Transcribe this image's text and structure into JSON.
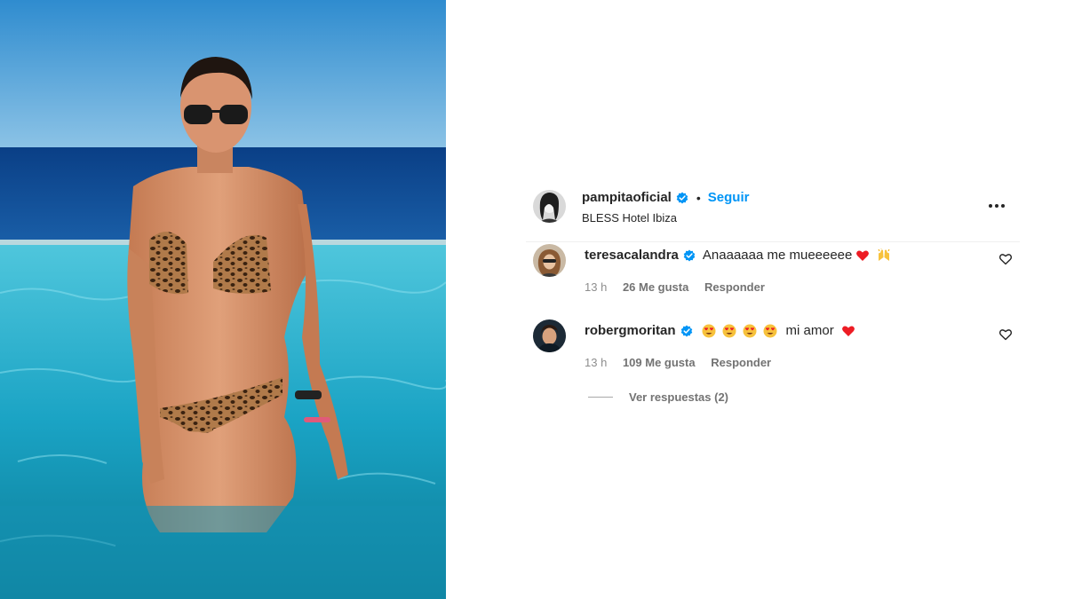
{
  "post": {
    "author": "pampitaoficial",
    "verified": true,
    "separator": "•",
    "follow_label": "Seguir",
    "location": "BLESS Hotel Ibiza",
    "more_icon": "more-horizontal-icon"
  },
  "comments": [
    {
      "username": "teresacalandra",
      "verified": true,
      "text": "Anaaaaaa me mueeeeee",
      "emojis": [
        "red-heart-emoji",
        "raising-hands-emoji"
      ],
      "time": "13 h",
      "likes": "26 Me gusta",
      "reply": "Responder"
    },
    {
      "username": "robergmoritan",
      "verified": true,
      "emojis_before": [
        "heart-eyes-emoji",
        "heart-eyes-emoji",
        "heart-eyes-emoji",
        "heart-eyes-emoji"
      ],
      "text": "mi amor",
      "emojis": [
        "red-heart-emoji"
      ],
      "time": "13 h",
      "likes": "109 Me gusta",
      "reply": "Responder",
      "view_replies": "Ver respuestas (2)"
    }
  ],
  "colors": {
    "link_blue": "#0095f6",
    "verified_blue": "#0095f6",
    "muted_text": "#737373",
    "heart_red": "#ed1c24"
  }
}
